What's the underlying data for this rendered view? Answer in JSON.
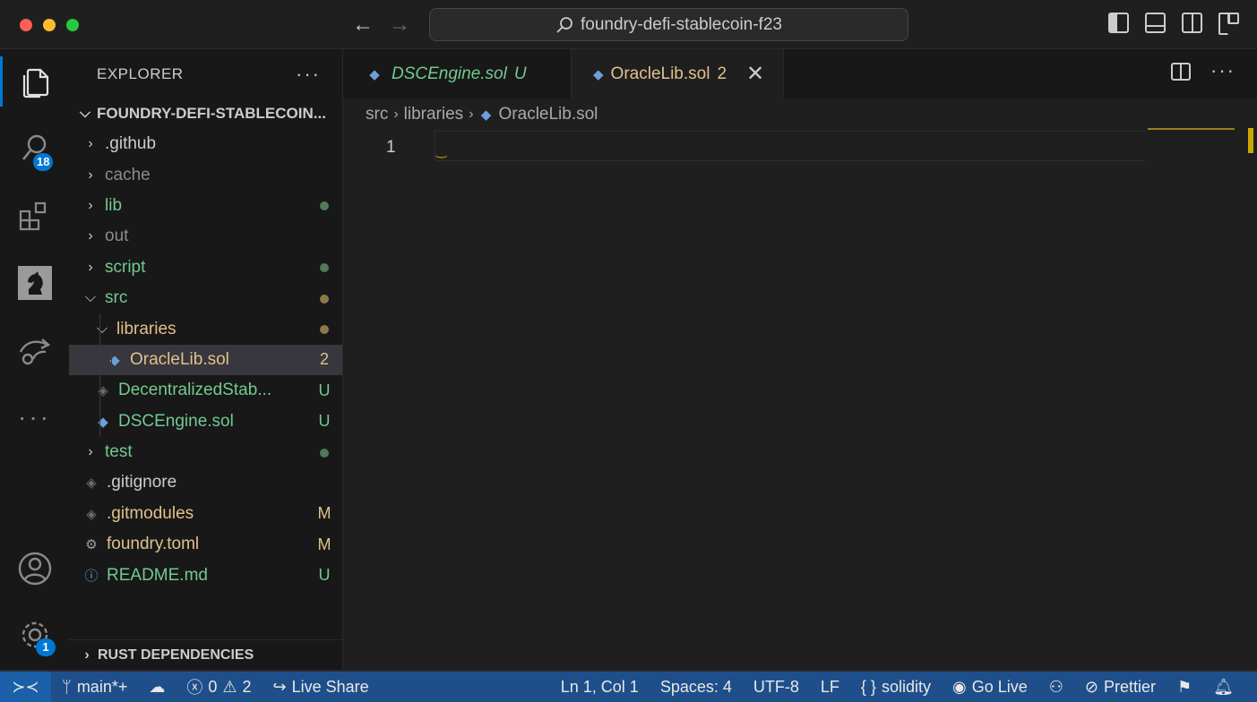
{
  "titlebar": {
    "search_text": "foundry-defi-stablecoin-f23"
  },
  "activity_bar": {
    "search_badge": "18",
    "settings_badge": "1"
  },
  "sidebar": {
    "header": "EXPLORER",
    "more": "···",
    "folder": "FOUNDRY-DEFI-STABLECOIN...",
    "items": [
      {
        "name": ".github",
        "type": "folder",
        "expanded": false,
        "color": "white",
        "decoration": ""
      },
      {
        "name": "cache",
        "type": "folder",
        "expanded": false,
        "color": "gray",
        "decoration": ""
      },
      {
        "name": "lib",
        "type": "folder",
        "expanded": false,
        "color": "green",
        "decoration": "dot"
      },
      {
        "name": "out",
        "type": "folder",
        "expanded": false,
        "color": "gray",
        "decoration": ""
      },
      {
        "name": "script",
        "type": "folder",
        "expanded": false,
        "color": "green",
        "decoration": "dot"
      },
      {
        "name": "src",
        "type": "folder",
        "expanded": true,
        "color": "green",
        "decoration": "dot-yellow"
      },
      {
        "name": "libraries",
        "type": "folder",
        "expanded": true,
        "color": "yellow",
        "decoration": "dot-yellow"
      },
      {
        "name": "OracleLib.sol",
        "type": "file",
        "color": "yellow",
        "decoration": "2"
      },
      {
        "name": "DecentralizedStab...",
        "type": "file",
        "color": "green",
        "decoration": "U"
      },
      {
        "name": "DSCEngine.sol",
        "type": "file",
        "color": "green",
        "decoration": "U"
      },
      {
        "name": "test",
        "type": "folder",
        "expanded": false,
        "color": "green",
        "decoration": "dot"
      },
      {
        "name": ".gitignore",
        "type": "file",
        "color": "white",
        "decoration": ""
      },
      {
        "name": ".gitmodules",
        "type": "file",
        "color": "yellow",
        "decoration": "M"
      },
      {
        "name": "foundry.toml",
        "type": "file",
        "color": "yellow",
        "decoration": "M"
      },
      {
        "name": "README.md",
        "type": "file",
        "color": "green",
        "decoration": "U"
      }
    ],
    "footer": "RUST DEPENDENCIES"
  },
  "tabs": [
    {
      "label": "DSCEngine.sol",
      "status": "U",
      "active": false
    },
    {
      "label": "OracleLib.sol",
      "status": "2",
      "active": true
    }
  ],
  "breadcrumb": [
    "src",
    "libraries",
    "OracleLib.sol"
  ],
  "editor": {
    "line_number": "1"
  },
  "statusbar": {
    "branch": "main*+",
    "errors": "0",
    "warnings": "2",
    "live_share": "Live Share",
    "position": "Ln 1, Col 1",
    "spaces": "Spaces: 4",
    "encoding": "UTF-8",
    "eol": "LF",
    "language": "solidity",
    "go_live": "Go Live",
    "prettier": "Prettier"
  },
  "colors": {
    "accent": "#0078d4",
    "git_untracked": "#73c991",
    "git_modified": "#e2c08d",
    "statusbar": "#1f4f8a"
  }
}
